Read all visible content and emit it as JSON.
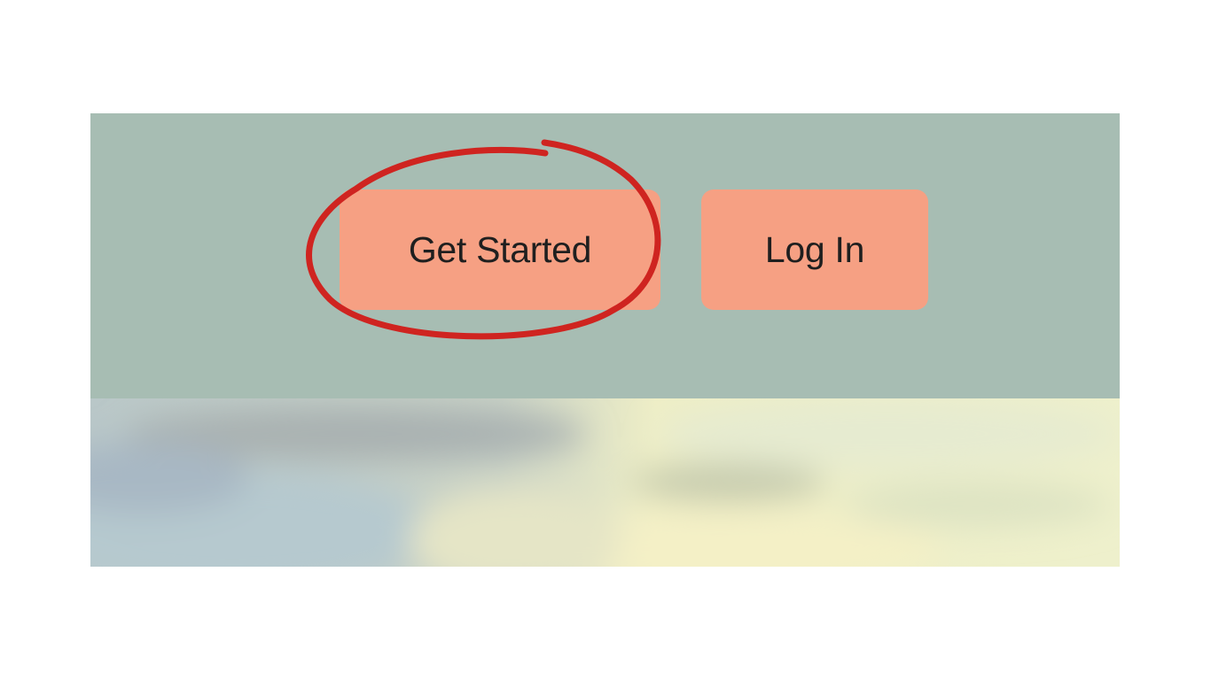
{
  "colors": {
    "header_background": "#a7bdb3",
    "button_background": "#f6a083",
    "button_text": "#1f1f1f",
    "annotation_stroke": "#cf2420"
  },
  "header": {
    "get_started_label": "Get Started",
    "login_label": "Log In"
  },
  "annotation": {
    "type": "hand-drawn-circle",
    "target": "get-started-button"
  }
}
